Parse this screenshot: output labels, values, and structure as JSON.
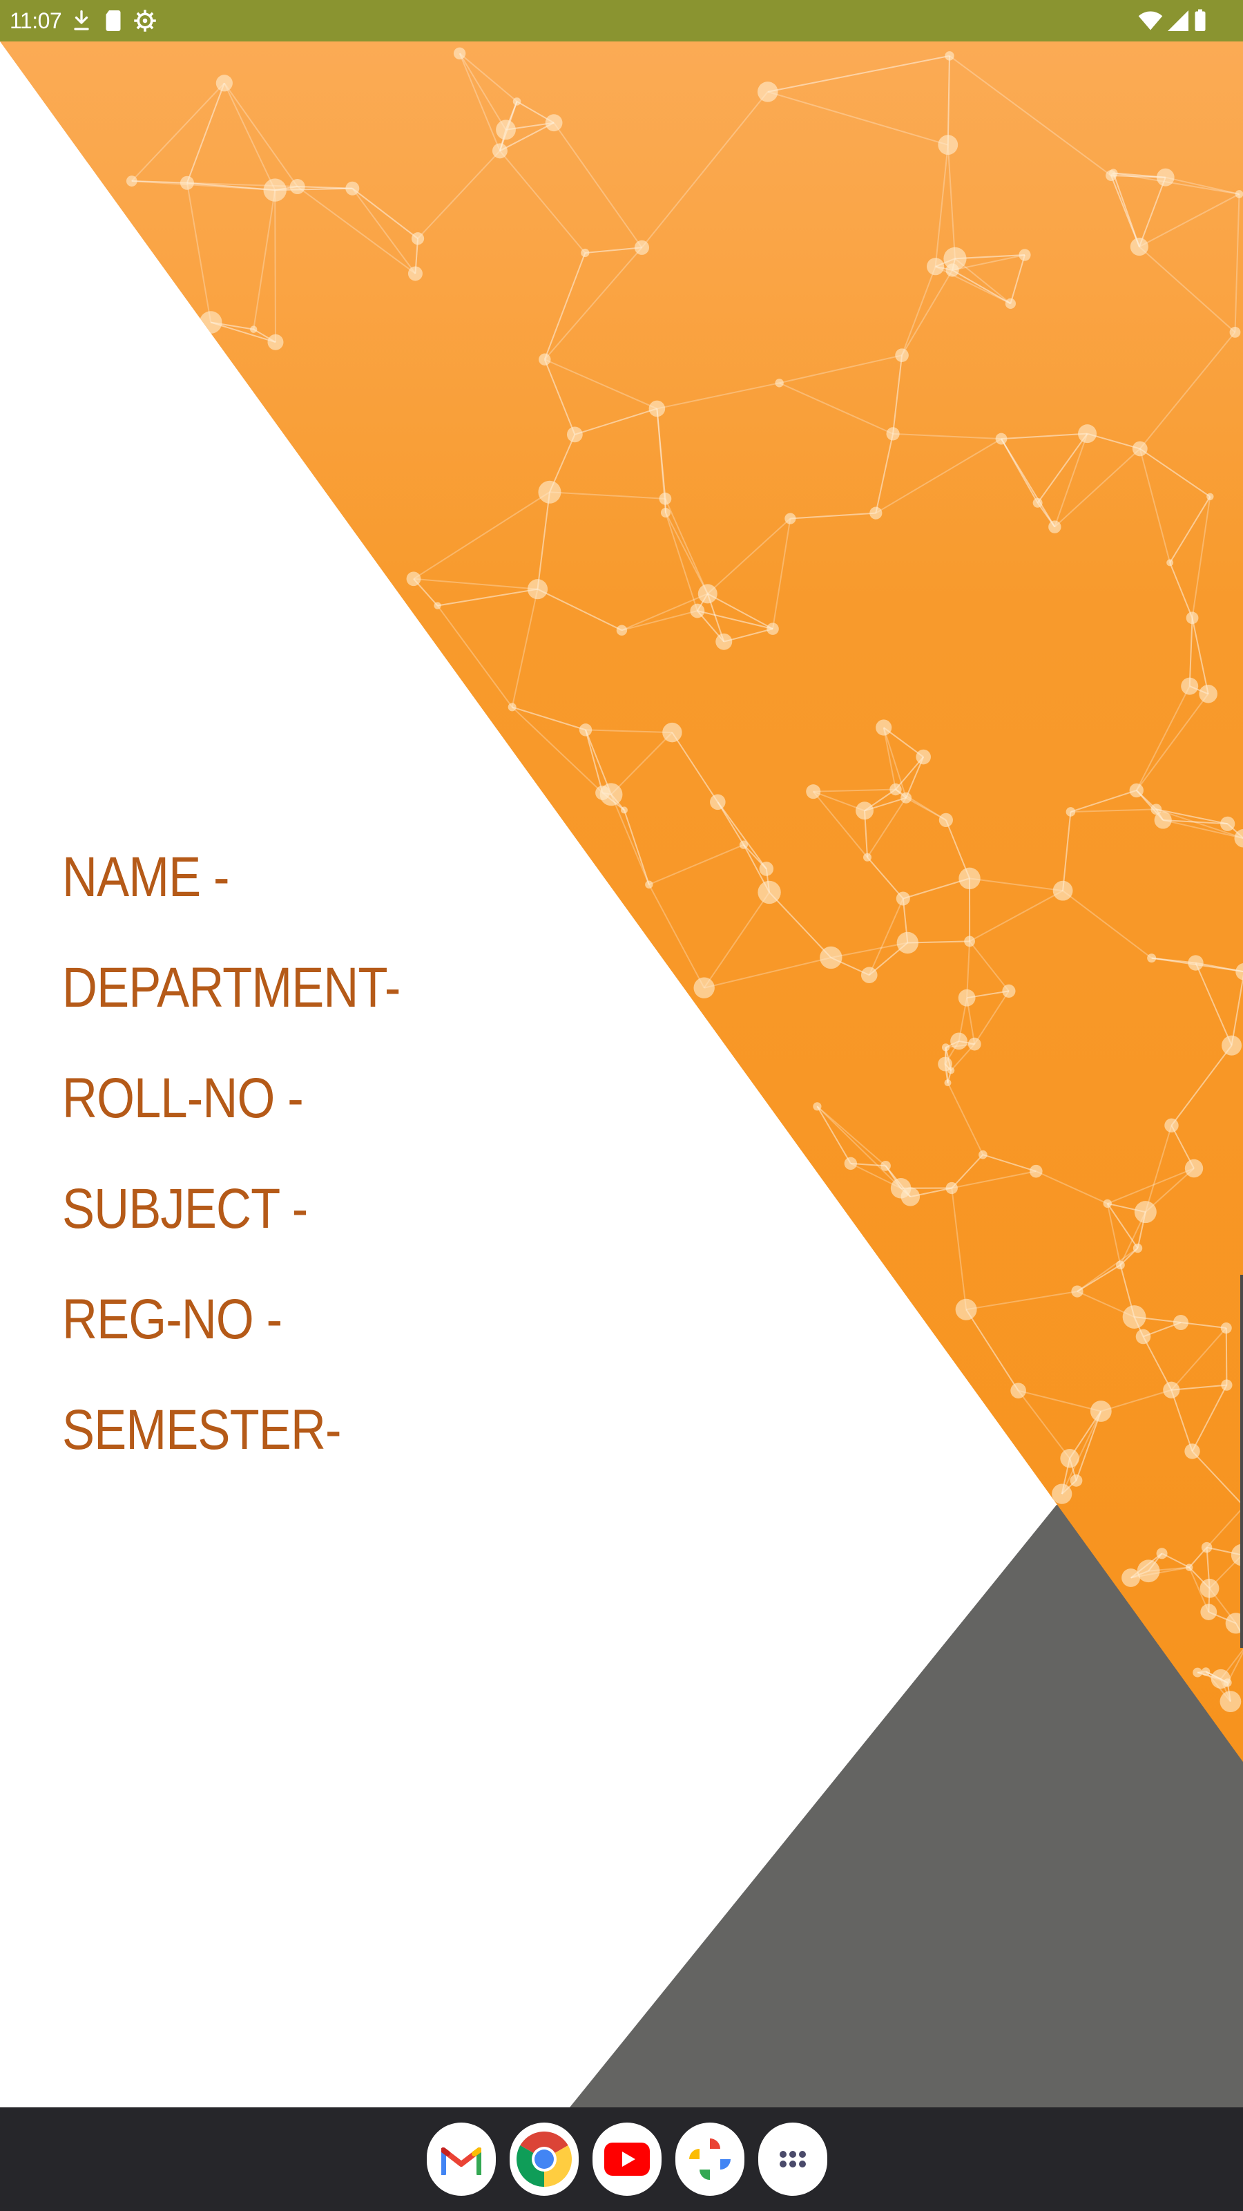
{
  "status_bar": {
    "time": "11:07",
    "left_icons": [
      "download-icon",
      "sd-card-icon",
      "gear-icon"
    ],
    "right_icons": [
      "wifi-icon",
      "signal-icon",
      "battery-icon"
    ]
  },
  "document": {
    "fields": [
      "NAME -",
      "DEPARTMENT-",
      "ROLL-NO -",
      "SUBJECT -",
      "REG-NO -",
      "SEMESTER-"
    ],
    "colors": {
      "label": "#b55a18",
      "orange_top": "#fbab55",
      "orange_bottom": "#f7931e",
      "gray": "#646462"
    }
  },
  "taskbar": {
    "apps": [
      "Gmail",
      "Chrome",
      "YouTube",
      "Photos",
      "All apps"
    ]
  }
}
